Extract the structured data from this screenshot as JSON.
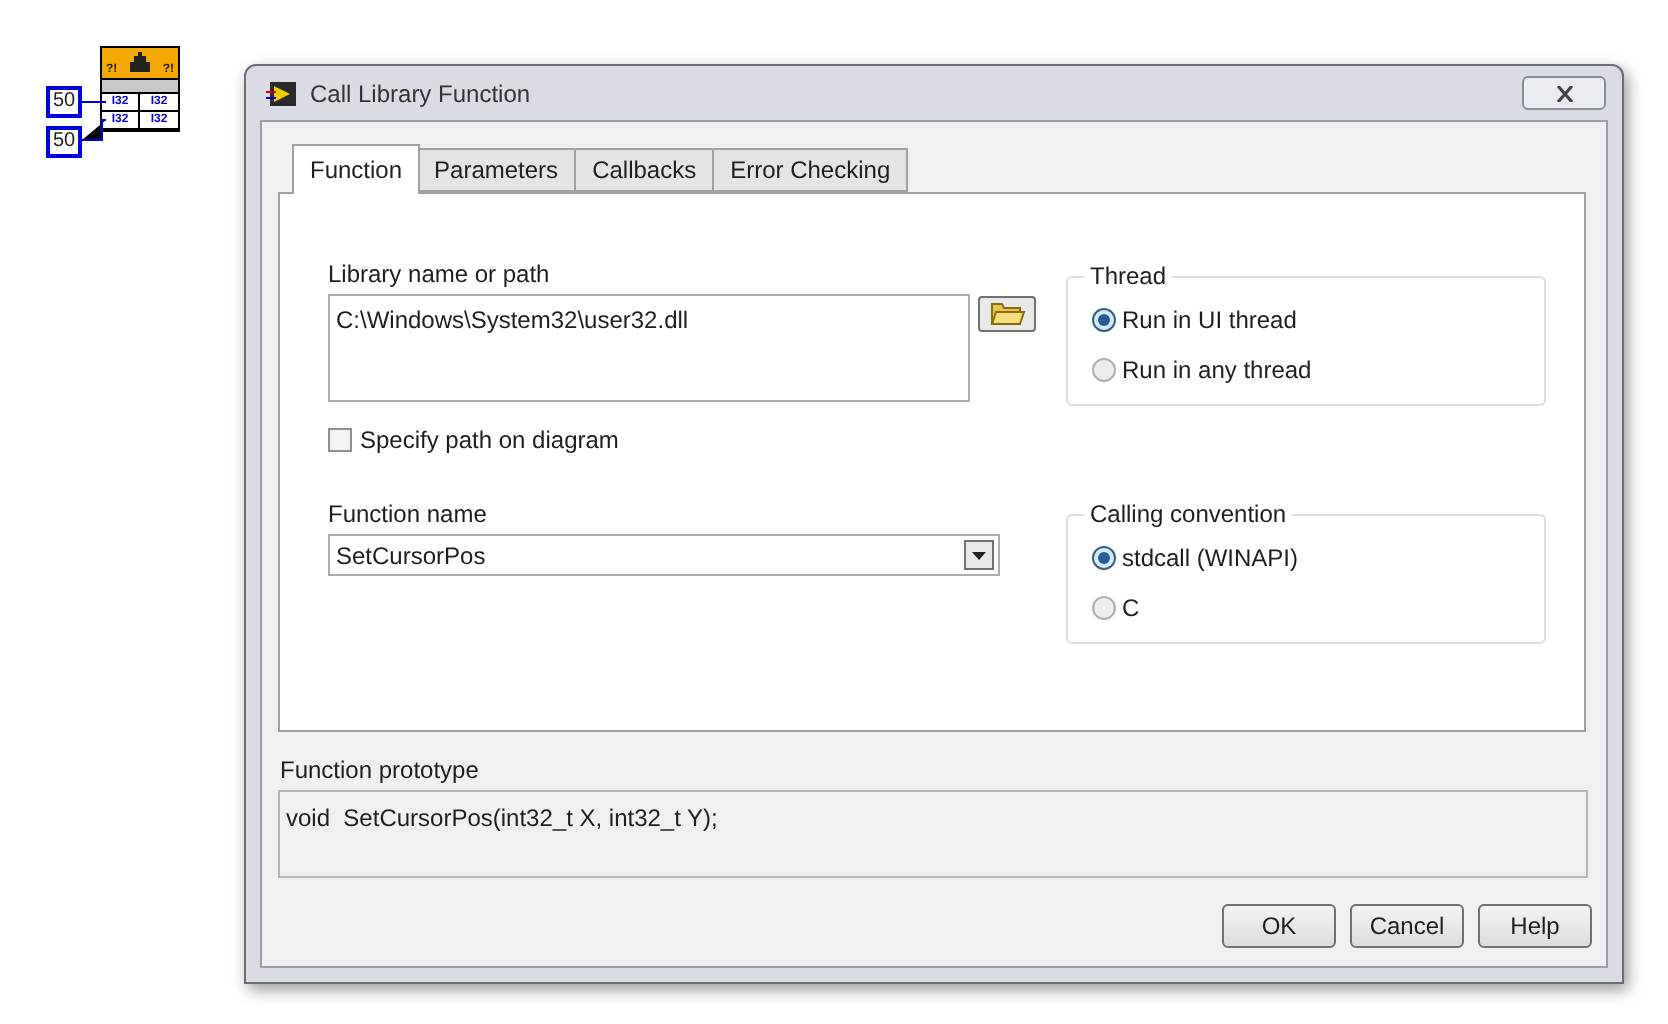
{
  "diagram": {
    "constants": [
      "50",
      "50"
    ],
    "node_flags": [
      "?!",
      "?!"
    ],
    "terminals": [
      "I32",
      "I32",
      "I32",
      "I32"
    ]
  },
  "window": {
    "title": "Call Library Function"
  },
  "tabs": [
    {
      "label": "Function",
      "selected": true
    },
    {
      "label": "Parameters",
      "selected": false
    },
    {
      "label": "Callbacks",
      "selected": false
    },
    {
      "label": "Error Checking",
      "selected": false
    }
  ],
  "library": {
    "label": "Library name or path",
    "value": "C:\\Windows\\System32\\user32.dll",
    "specify_path": {
      "label": "Specify path on diagram",
      "checked": false
    }
  },
  "function_name": {
    "label": "Function name",
    "value": "SetCursorPos"
  },
  "thread": {
    "title": "Thread",
    "options": [
      {
        "label": "Run in UI thread",
        "selected": true
      },
      {
        "label": "Run in any thread",
        "selected": false
      }
    ]
  },
  "calling_convention": {
    "title": "Calling convention",
    "options": [
      {
        "label": "stdcall (WINAPI)",
        "selected": true
      },
      {
        "label": "C",
        "selected": false
      }
    ]
  },
  "prototype": {
    "label": "Function prototype",
    "value": "void  SetCursorPos(int32_t X, int32_t Y);"
  },
  "buttons": [
    "OK",
    "Cancel",
    "Help"
  ]
}
